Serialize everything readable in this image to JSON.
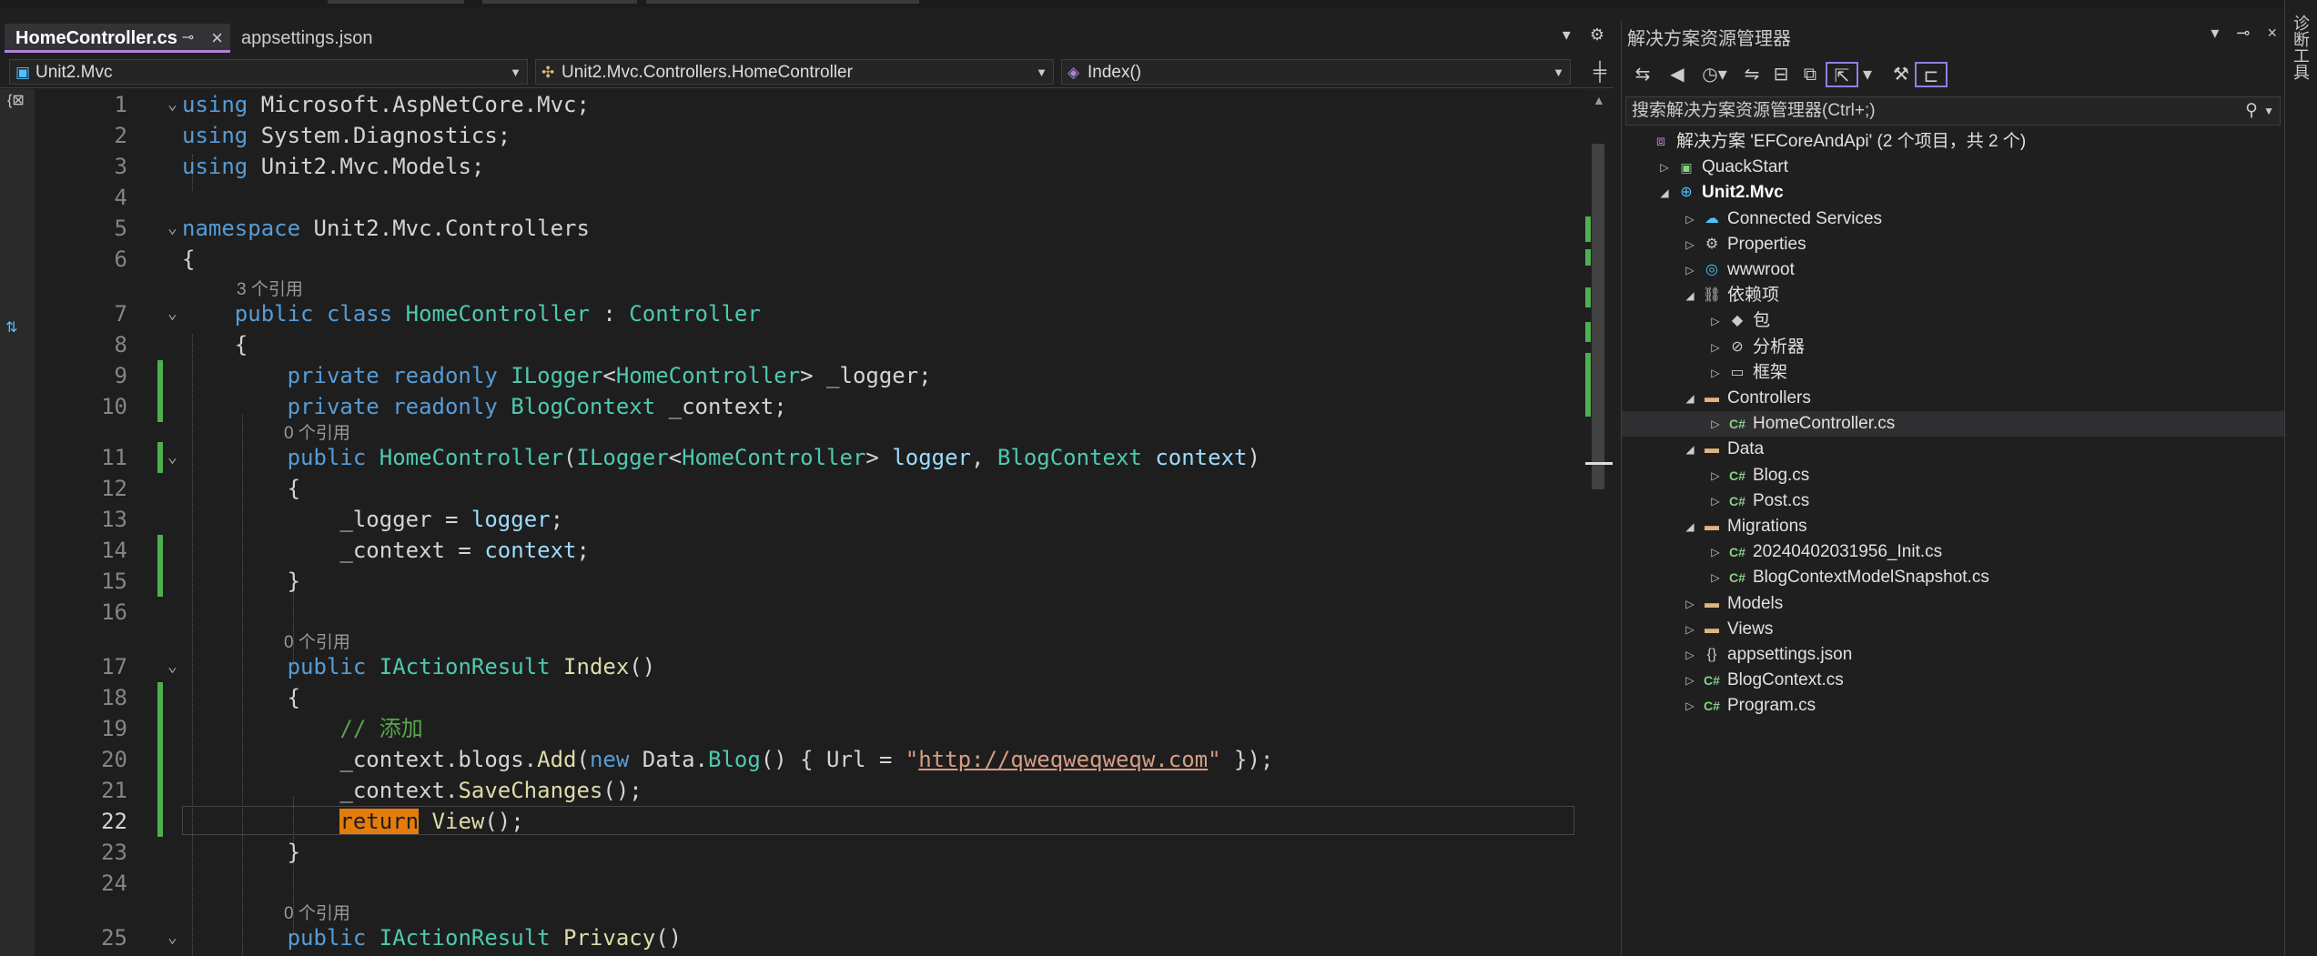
{
  "editor": {
    "tabs": [
      {
        "label": "HomeController.cs",
        "active": true
      },
      {
        "label": "appsettings.json",
        "active": false
      }
    ],
    "nav": {
      "project": "Unit2.Mvc",
      "type": "Unit2.Mvc.Controllers.HomeController",
      "member": "Index()"
    },
    "current_line": 22,
    "refs": {
      "r3": "3 个引用",
      "r0": "0 个引用"
    },
    "string_literal": "http://qweqweqweqw.com"
  },
  "solution_explorer": {
    "title": "解决方案资源管理器",
    "search_placeholder": "搜索解决方案资源管理器(Ctrl+;)",
    "tree": [
      {
        "label": "解决方案 'EFCoreAndApi' (2 个项目，共 2 个)",
        "icon": "solution-icon",
        "depth": 0,
        "expander": ""
      },
      {
        "label": "QuackStart",
        "icon": "csharp-project-icon",
        "depth": 1,
        "expander": "collapsed"
      },
      {
        "label": "Unit2.Mvc",
        "icon": "web-project-icon",
        "depth": 1,
        "expander": "expanded",
        "bold": true
      },
      {
        "label": "Connected Services",
        "icon": "connected-services-icon",
        "depth": 2,
        "expander": "collapsed"
      },
      {
        "label": "Properties",
        "icon": "properties-icon",
        "depth": 2,
        "expander": "collapsed"
      },
      {
        "label": "wwwroot",
        "icon": "globe-icon",
        "depth": 2,
        "expander": "collapsed"
      },
      {
        "label": "依赖项",
        "icon": "dependencies-icon",
        "depth": 2,
        "expander": "expanded"
      },
      {
        "label": "包",
        "icon": "package-icon",
        "depth": 3,
        "expander": "collapsed"
      },
      {
        "label": "分析器",
        "icon": "analyzer-icon",
        "depth": 3,
        "expander": "collapsed"
      },
      {
        "label": "框架",
        "icon": "framework-icon",
        "depth": 3,
        "expander": "collapsed"
      },
      {
        "label": "Controllers",
        "icon": "folder-icon",
        "depth": 2,
        "expander": "expanded"
      },
      {
        "label": "HomeController.cs",
        "icon": "csharp-file-icon",
        "depth": 3,
        "expander": "collapsed",
        "selected": true
      },
      {
        "label": "Data",
        "icon": "folder-icon",
        "depth": 2,
        "expander": "expanded"
      },
      {
        "label": "Blog.cs",
        "icon": "csharp-file-icon",
        "depth": 3,
        "expander": "collapsed"
      },
      {
        "label": "Post.cs",
        "icon": "csharp-file-icon",
        "depth": 3,
        "expander": "collapsed"
      },
      {
        "label": "Migrations",
        "icon": "folder-icon",
        "depth": 2,
        "expander": "expanded"
      },
      {
        "label": "20240402031956_Init.cs",
        "icon": "csharp-file-icon",
        "depth": 3,
        "expander": "collapsed"
      },
      {
        "label": "BlogContextModelSnapshot.cs",
        "icon": "csharp-file-icon",
        "depth": 3,
        "expander": "collapsed"
      },
      {
        "label": "Models",
        "icon": "folder-icon",
        "depth": 2,
        "expander": "collapsed"
      },
      {
        "label": "Views",
        "icon": "folder-icon",
        "depth": 2,
        "expander": "collapsed"
      },
      {
        "label": "appsettings.json",
        "icon": "json-file-icon",
        "depth": 2,
        "expander": "collapsed"
      },
      {
        "label": "BlogContext.cs",
        "icon": "csharp-file-icon",
        "depth": 2,
        "expander": "collapsed"
      },
      {
        "label": "Program.cs",
        "icon": "csharp-file-icon",
        "depth": 2,
        "expander": "collapsed"
      }
    ]
  },
  "side_tool": {
    "label": "诊断工具"
  }
}
